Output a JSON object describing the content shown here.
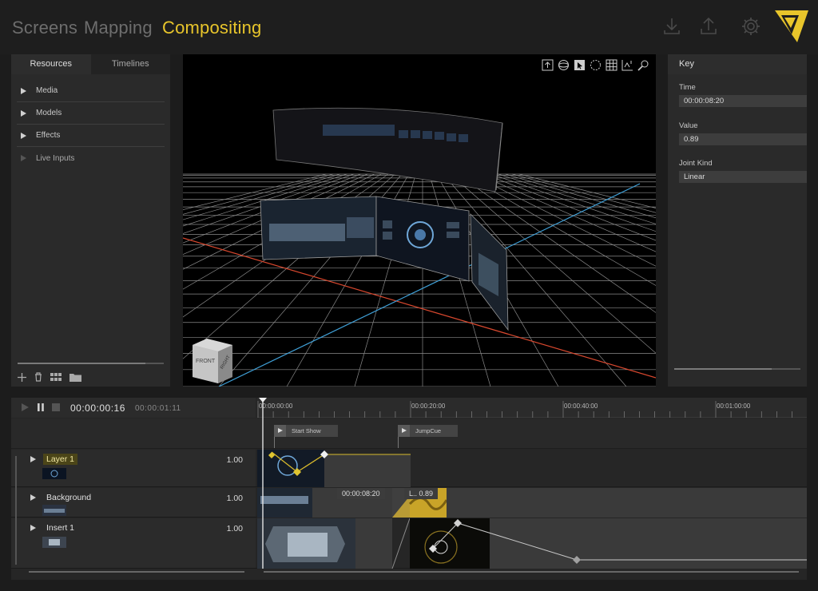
{
  "main_tabs": [
    {
      "label": "Screens",
      "active": false
    },
    {
      "label": "Mapping",
      "active": false
    },
    {
      "label": "Compositing",
      "active": true
    }
  ],
  "top_icons": [
    "download-icon",
    "upload-icon",
    "gear-icon"
  ],
  "accent_color": "#e8c52b",
  "left_panel": {
    "tabs": [
      {
        "label": "Resources",
        "active": true
      },
      {
        "label": "Timelines",
        "active": false
      }
    ],
    "items": [
      {
        "label": "Media"
      },
      {
        "label": "Models"
      },
      {
        "label": "Effects"
      },
      {
        "label": "Live Inputs"
      }
    ],
    "footer_icons": [
      "add-icon",
      "trash-icon",
      "grid-icon",
      "folder-icon"
    ]
  },
  "viewport": {
    "toolbar_icons": [
      "export-icon",
      "sphere-icon",
      "select-icon",
      "lasso-icon",
      "grid-icon",
      "snap-icon",
      "zoom-icon"
    ],
    "view_cube": {
      "front": "FRONT",
      "right": "RIGHT"
    }
  },
  "right_panel": {
    "header": "Key",
    "time_label": "Time",
    "time_value": "00:00:08:20",
    "value_label": "Value",
    "value_value": "0.89",
    "joint_label": "Joint Kind",
    "joint_value": "Linear"
  },
  "timeline": {
    "current_time": "00:00:00:16",
    "total_time": "00:00:01:11",
    "ruler": [
      "00:00:00:00",
      "00:00:20:00",
      "00:00:40:00",
      "00:01:00:00"
    ],
    "cues": [
      {
        "label": "Start Show"
      },
      {
        "label": "JumpCue"
      }
    ],
    "layers": [
      {
        "name": "Layer 1",
        "value": "1.00",
        "selected": true
      },
      {
        "name": "Background",
        "value": "1.00",
        "selected": false
      },
      {
        "name": "Insert 1",
        "value": "1.00",
        "selected": false
      }
    ],
    "key_tooltip_time": "00:00:08:20",
    "key_tooltip_value": "L..  0.89"
  }
}
